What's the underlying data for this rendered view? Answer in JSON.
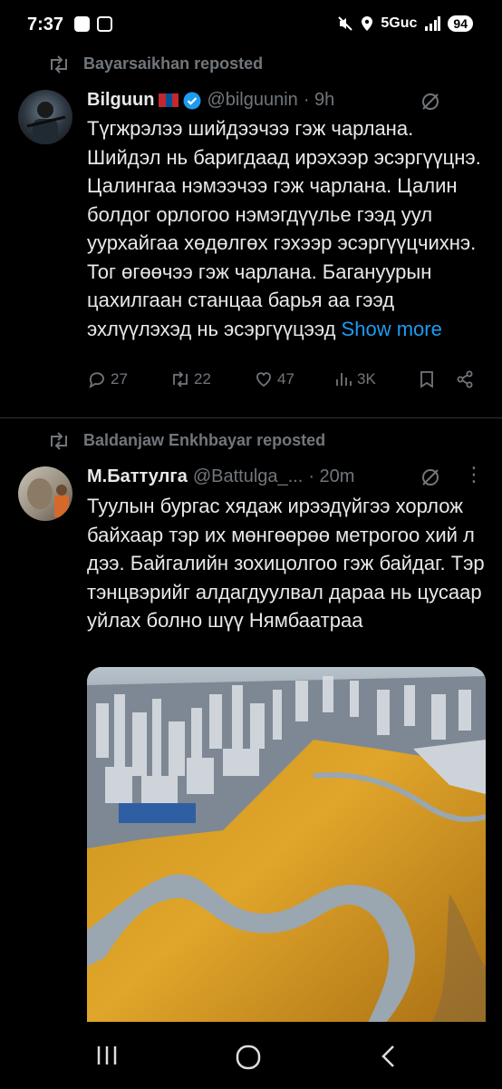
{
  "status_bar": {
    "time": "7:37",
    "network": "5Guc",
    "battery": "94"
  },
  "tweets": [
    {
      "repost_label": "Bayarsaikhan reposted",
      "name": "Bilguun",
      "handle": "@bilguunin",
      "time": "· 9h",
      "verified": true,
      "flag": "mongolia-flag",
      "text": "Түгжрэлээ шийдээчээ гэж чарлана. Шийдэл нь баригдаад ирэхээр эсэргүүцнэ. Цалингаа нэмээчээ гэж чарлана. Цалин болдог орлогоо нэмэгдүүлье гээд уул уурхайгаа хөдөлгөх гэхээр эсэргүүцчихнэ. Тог өгөөчээ гэж чарлана. Багануурын цахилгаан станцаа барья аа гээд эхлүүлэхэд нь эсэргүүцээд",
      "show_more": "Show more",
      "replies": "27",
      "reposts": "22",
      "likes": "47",
      "views": "3K"
    },
    {
      "repost_label": "Baldanjaw Enkhbayar reposted",
      "name": "М.Баттулга",
      "handle": "@Battulga_...",
      "time": "· 20m",
      "text": "Туулын бургас хядаж ирээдүйгээ хорлож байхаар тэр их мөнгөөрөө метрогоо хий л дээ. Байгалийн зохицолгоо гэж байдаг. Тэр тэнцвэрийг алдагдуулвал дараа нь цусаар уйлах болно шүү Нямбаатраа"
    }
  ],
  "nav": {
    "recents": "recents-icon",
    "home": "home-icon",
    "back": "back-icon"
  },
  "colors": {
    "accent": "#1d9bf0",
    "muted": "#71767b",
    "background": "#000000"
  }
}
